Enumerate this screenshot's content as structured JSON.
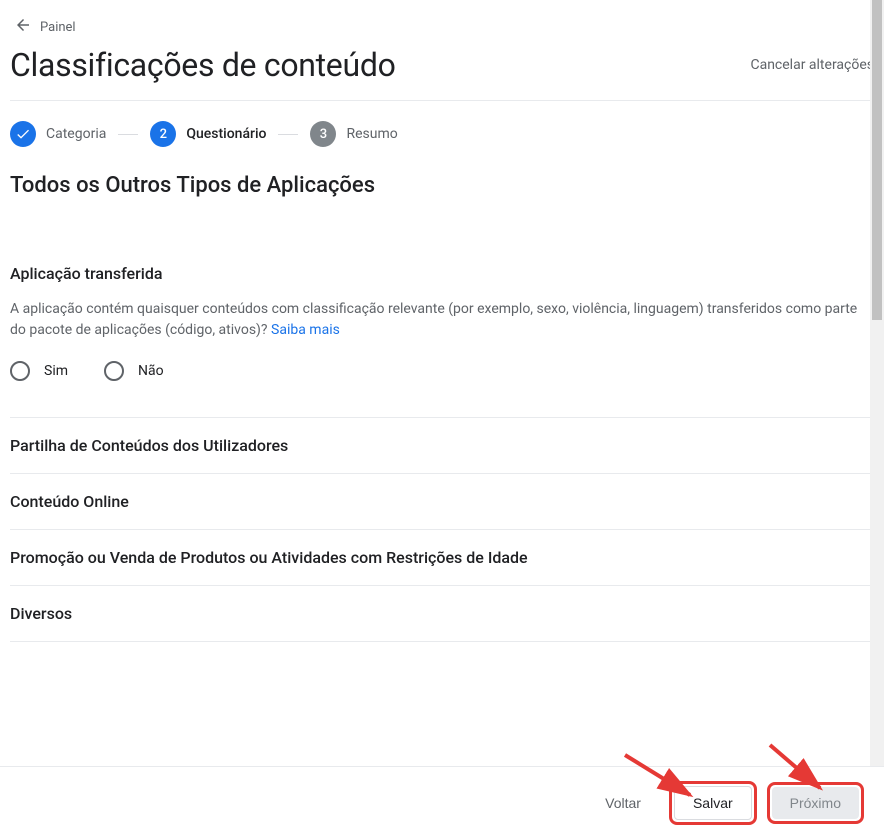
{
  "breadcrumb": {
    "label": "Painel"
  },
  "header": {
    "title": "Classificações de conteúdo",
    "cancel": "Cancelar alterações"
  },
  "stepper": {
    "steps": [
      {
        "label": "Categoria",
        "state": "done"
      },
      {
        "label": "Questionário",
        "state": "current",
        "num": "2"
      },
      {
        "label": "Resumo",
        "state": "pending",
        "num": "3"
      }
    ]
  },
  "subtitle": "Todos os Outros Tipos de Aplicações",
  "sections": {
    "transferred": {
      "title": "Aplicação transferida",
      "desc_part1": "A aplicação contém quaisquer conteúdos com classificação relevante (por exemplo, sexo, violência, linguagem) transferidos como parte do pacote de aplicações (código, ativos)? ",
      "learn_more": "Saiba mais",
      "radio_yes": "Sim",
      "radio_no": "Não"
    },
    "sharing": {
      "title": "Partilha de Conteúdos dos Utilizadores"
    },
    "online": {
      "title": "Conteúdo Online"
    },
    "promo": {
      "title": "Promoção ou Venda de Produtos ou Atividades com Restrições de Idade"
    },
    "misc": {
      "title": "Diversos"
    }
  },
  "footer": {
    "back": "Voltar",
    "save": "Salvar",
    "next": "Próximo"
  }
}
